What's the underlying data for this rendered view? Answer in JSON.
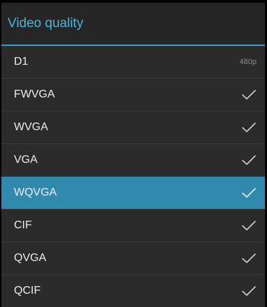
{
  "dialog": {
    "title": "Video quality"
  },
  "options": [
    {
      "label": "D1",
      "tag": "480p",
      "icon": null,
      "selected": false
    },
    {
      "label": "FWVGA",
      "tag": "",
      "icon": "checkmark-icon",
      "selected": false
    },
    {
      "label": "WVGA",
      "tag": "",
      "icon": "checkmark-icon",
      "selected": false
    },
    {
      "label": "VGA",
      "tag": "",
      "icon": "checkmark-icon",
      "selected": false
    },
    {
      "label": "WQVGA",
      "tag": "",
      "icon": "checkmark-icon",
      "selected": true
    },
    {
      "label": "CIF",
      "tag": "",
      "icon": "checkmark-icon",
      "selected": false
    },
    {
      "label": "QVGA",
      "tag": "",
      "icon": "checkmark-icon",
      "selected": false
    },
    {
      "label": "QCIF",
      "tag": "",
      "icon": "checkmark-icon",
      "selected": false
    }
  ],
  "colors": {
    "accent": "#4fb3dc",
    "selected_row": "#3189ad",
    "background": "#2b2b2b"
  }
}
